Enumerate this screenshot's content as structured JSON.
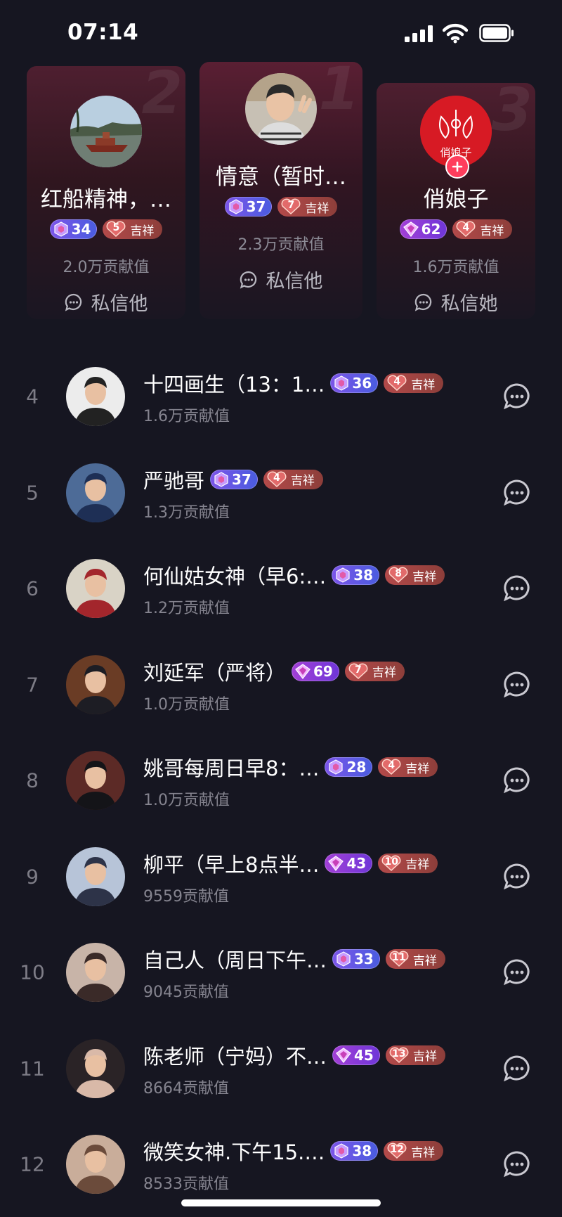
{
  "status_bar": {
    "time": "07:14"
  },
  "podium": [
    {
      "rank": "2",
      "name": "红船精神，…",
      "level": "34",
      "level_style": "blue",
      "fan_level": "5",
      "fan_label": "吉祥",
      "contribution": "2.0万贡献值",
      "message": "私信他",
      "avatar": "boat-photo"
    },
    {
      "rank": "1",
      "name": "情意（暂时…",
      "level": "37",
      "level_style": "blue",
      "fan_level": "7",
      "fan_label": "吉祥",
      "contribution": "2.3万贡献值",
      "message": "私信他",
      "avatar": "man-photo"
    },
    {
      "rank": "3",
      "name": "俏娘子",
      "level": "62",
      "level_style": "purple",
      "fan_level": "4",
      "fan_label": "吉祥",
      "contribution": "1.6万贡献值",
      "message": "私信她",
      "avatar": "red-logo",
      "logo_text": "俏娘子"
    }
  ],
  "list": [
    {
      "rank": "4",
      "name": "十四画生（13：1…",
      "level": "36",
      "level_style": "blue",
      "fan_level": "4",
      "fan_label": "吉祥",
      "contribution": "1.6万贡献值",
      "avatar_bg": "#ececec",
      "avatar_fg": "#222"
    },
    {
      "rank": "5",
      "name": "严驰哥",
      "level": "37",
      "level_style": "blue",
      "fan_level": "4",
      "fan_label": "吉祥",
      "contribution": "1.3万贡献值",
      "avatar_bg": "#4d6b97",
      "avatar_fg": "#1e2f55"
    },
    {
      "rank": "6",
      "name": "何仙姑女神（早6:…",
      "level": "38",
      "level_style": "blue",
      "fan_level": "8",
      "fan_label": "吉祥",
      "contribution": "1.2万贡献值",
      "avatar_bg": "#d9d3c6",
      "avatar_fg": "#a3262c"
    },
    {
      "rank": "7",
      "name": "刘延军（严将）",
      "level": "69",
      "level_style": "purple",
      "fan_level": "7",
      "fan_label": "吉祥",
      "contribution": "1.0万贡献值",
      "avatar_bg": "#6a3c25",
      "avatar_fg": "#1d1d24"
    },
    {
      "rank": "8",
      "name": "姚哥每周日早8：…",
      "level": "28",
      "level_style": "blue",
      "fan_level": "4",
      "fan_label": "吉祥",
      "contribution": "1.0万贡献值",
      "avatar_bg": "#5c2a26",
      "avatar_fg": "#141418"
    },
    {
      "rank": "9",
      "name": "柳平（早上8点半…",
      "level": "43",
      "level_style": "purple",
      "fan_level": "10",
      "fan_label": "吉祥",
      "contribution": "9559贡献值",
      "avatar_bg": "#b7c4d8",
      "avatar_fg": "#2d3348"
    },
    {
      "rank": "10",
      "name": "自己人（周日下午…",
      "level": "33",
      "level_style": "blue",
      "fan_level": "11",
      "fan_label": "吉祥",
      "contribution": "9045贡献值",
      "avatar_bg": "#c8b4a8",
      "avatar_fg": "#3a2a28"
    },
    {
      "rank": "11",
      "name": "陈老师（宁妈）不…",
      "level": "45",
      "level_style": "purple",
      "fan_level": "13",
      "fan_label": "吉祥",
      "contribution": "8664贡献值",
      "avatar_bg": "#2a2326",
      "avatar_fg": "#d9b9a8"
    },
    {
      "rank": "12",
      "name": "微笑女神.下午15.…",
      "level": "38",
      "level_style": "blue",
      "fan_level": "12",
      "fan_label": "吉祥",
      "contribution": "8533贡献值",
      "avatar_bg": "#c9ad9a",
      "avatar_fg": "#6b4b3b"
    }
  ],
  "colors": {
    "background": "#161621",
    "level_blue": "#5a5ae6",
    "level_purple": "#9a3ed8",
    "fan_badge": "#a4443f",
    "follow_button": "#ff3d5c"
  }
}
